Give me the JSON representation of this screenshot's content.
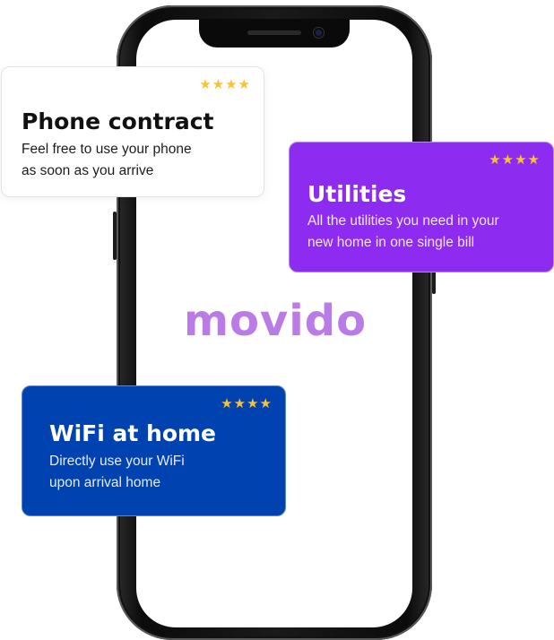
{
  "brand": {
    "logo_text": "movido",
    "logo_color": "#bb7be6"
  },
  "cards": [
    {
      "id": "phone",
      "stars": "★★★★",
      "title": "Phone contract",
      "desc_line1": "Feel free to use your phone",
      "desc_line2": "as soon as you arrive",
      "background": "#ffffff"
    },
    {
      "id": "utilities",
      "stars": "★★★★",
      "title": "Utilities",
      "desc_line1": "All the utilities you need in your",
      "desc_line2": "new home in one single bill",
      "background": "#8d2cf0"
    },
    {
      "id": "wifi",
      "stars": "★★★★",
      "title": "WiFi at home",
      "desc_line1": "Directly use your WiFi",
      "desc_line2": "upon arrival home",
      "background": "#0043b0"
    }
  ],
  "colors": {
    "star": "#f7c236"
  }
}
